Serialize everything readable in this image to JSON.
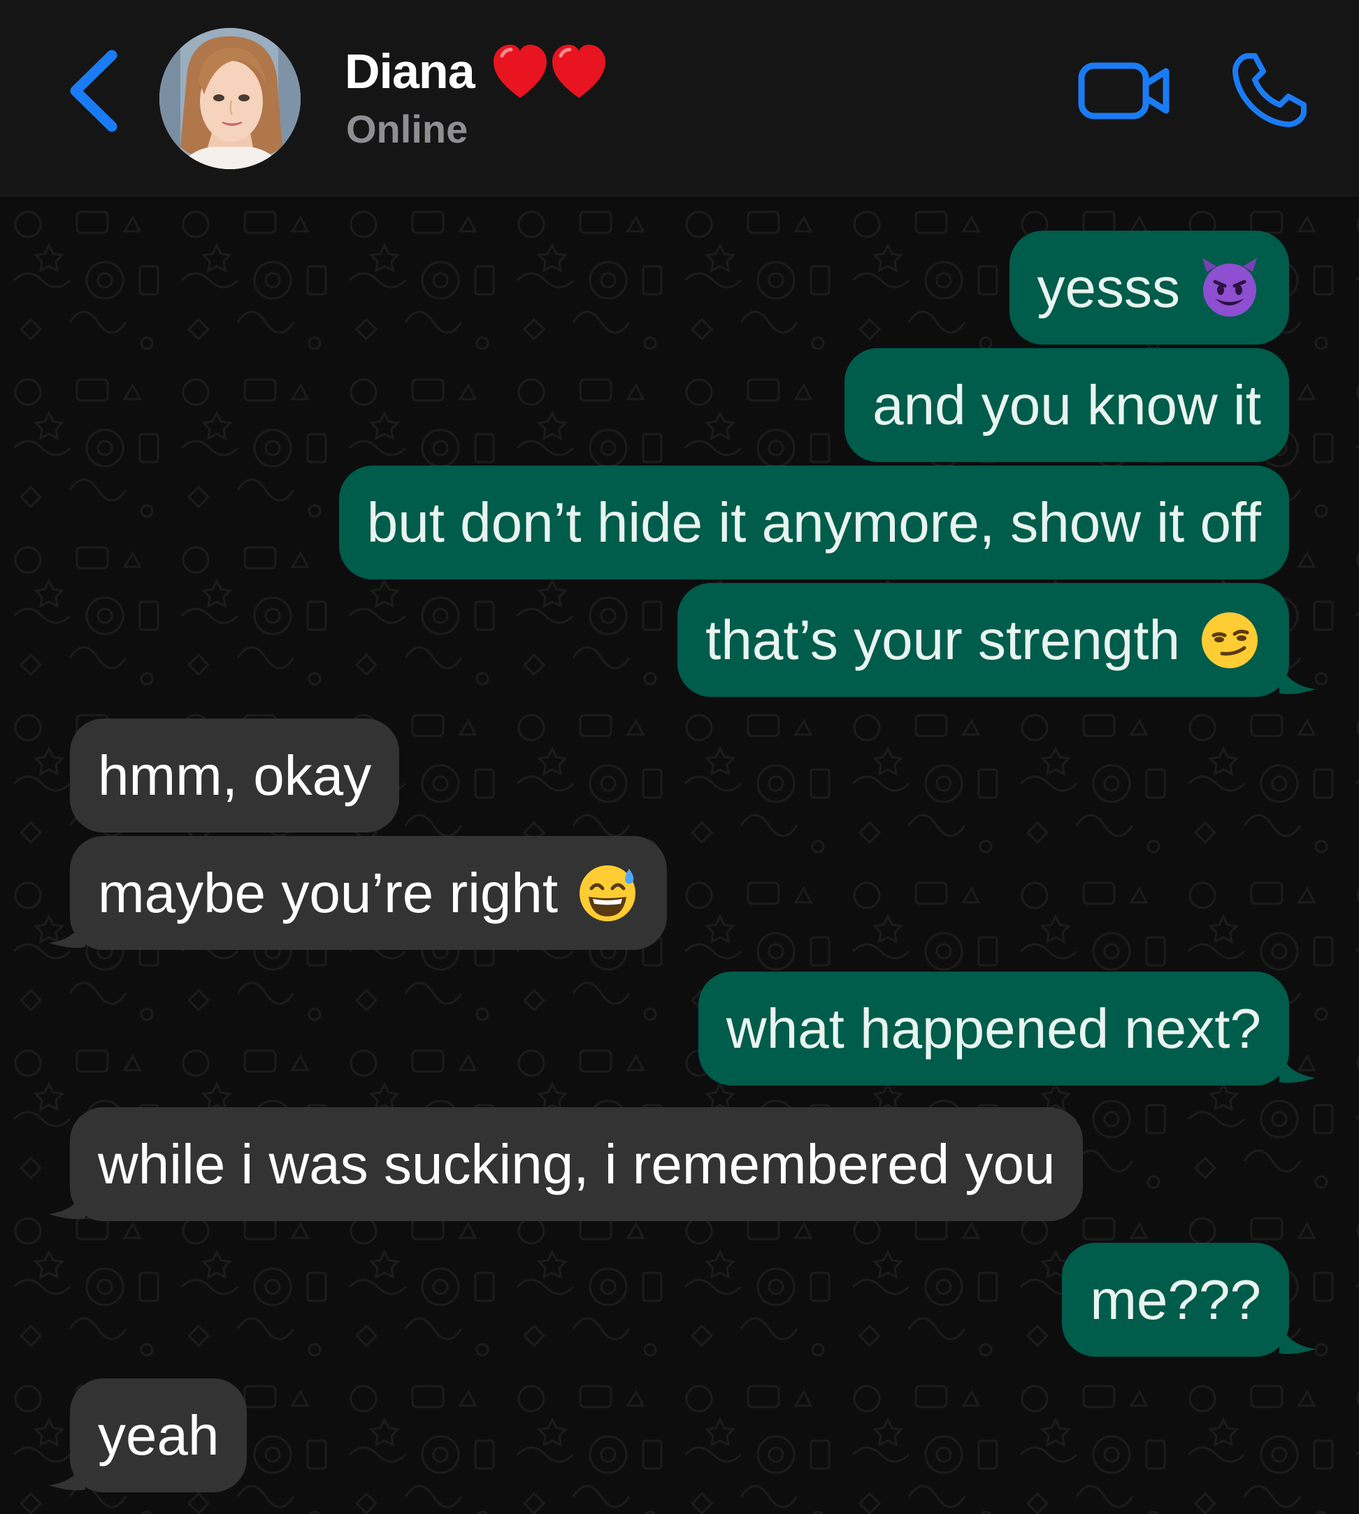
{
  "header": {
    "contact_name": "Diana",
    "name_emoji": "heart-emoji",
    "status": "Online",
    "accent_color": "#1a7cf5",
    "icons": [
      "back-chevron-icon",
      "video-camera-icon",
      "phone-icon"
    ]
  },
  "messages": [
    {
      "direction": "outgoing",
      "text": "yesss",
      "emoji": "smiling-devil-emoji"
    },
    {
      "direction": "outgoing",
      "text": "and you know it"
    },
    {
      "direction": "outgoing",
      "text": "but don’t hide it anymore, show it off"
    },
    {
      "direction": "outgoing",
      "text": "that’s your strength",
      "emoji": "smirking-face-emoji"
    },
    {
      "direction": "incoming",
      "text": "hmm, okay"
    },
    {
      "direction": "incoming",
      "text": "maybe you’re right",
      "emoji": "grinning-sweat-emoji"
    },
    {
      "direction": "outgoing",
      "text": "what happened next?"
    },
    {
      "direction": "incoming",
      "text": "while i was sucking, i remembered you"
    },
    {
      "direction": "outgoing",
      "text": "me???"
    },
    {
      "direction": "incoming",
      "text": "yeah"
    }
  ],
  "colors": {
    "header_bg": "#151515",
    "chat_bg": "#0d0d0d",
    "outgoing_bubble": "#005c4b",
    "incoming_bubble": "#333333",
    "status_text": "#8e8e93"
  }
}
